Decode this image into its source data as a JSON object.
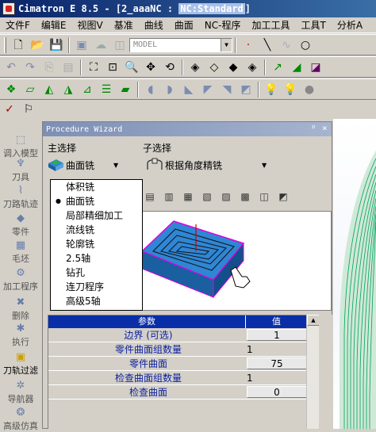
{
  "window": {
    "title_prefix": "Cimatron E 8.5 - [2_aaaNC : ",
    "title_highlight": "NC:Standard",
    "title_suffix": "]"
  },
  "menu": [
    "文件F",
    "编辑E",
    "视图V",
    "基准",
    "曲线",
    "曲面",
    "NC-程序",
    "加工工具",
    "工具T",
    "分析A"
  ],
  "toolbar": {
    "model_combo": "MODEL"
  },
  "left_panel": {
    "items": [
      "调入模型",
      "刀具",
      "刀路轨迹",
      "零件",
      "毛坯",
      "加工程序",
      "删除",
      "执行",
      "刀轨过滤",
      "导航器",
      "高级仿真"
    ]
  },
  "wizard": {
    "title": "Procedure Wizard",
    "main_select_label": "主选择",
    "sub_select_label": "子选择",
    "main_select_value": "曲面铣",
    "sub_select_value": "根据角度精铣",
    "main_options": [
      "体积铣",
      "曲面铣",
      "局部精细加工",
      "流线铣",
      "轮廓铣",
      "2.5轴",
      "钻孔",
      "连刀程序",
      "高级5轴"
    ],
    "selected_option": "曲面铣"
  },
  "params": {
    "col_param": "参数",
    "col_value": "值",
    "rows": [
      {
        "name": "边界 (可选)",
        "value": "1"
      },
      {
        "name": "零件曲面组数量",
        "value": "1"
      },
      {
        "name": "零件曲面",
        "value": "75"
      },
      {
        "name": "检查曲面组数量",
        "value": "1"
      },
      {
        "name": "检查曲面",
        "value": "0"
      }
    ]
  },
  "colors": {
    "title_bar": "#0a246a",
    "table_header": "#0a2ea8",
    "param_text": "#0a1fa0",
    "model_face": "#2f86d4",
    "model_edge": "#e000e0",
    "viewport_mesh": "#00a060"
  }
}
